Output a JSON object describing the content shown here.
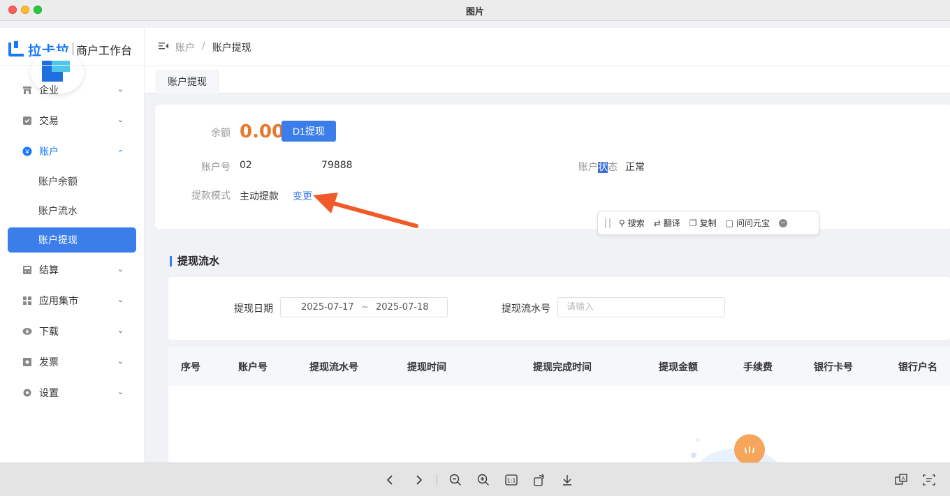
{
  "window": {
    "title": "图片"
  },
  "sidebar": {
    "brand": "拉卡拉",
    "brand_sub": "商户工作台",
    "menu": [
      {
        "label": "企业",
        "icon": "store-icon"
      },
      {
        "label": "交易",
        "icon": "check-square-icon"
      },
      {
        "label": "账户",
        "icon": "yen-circle-icon",
        "open": true,
        "children": [
          {
            "label": "账户余额"
          },
          {
            "label": "账户流水"
          },
          {
            "label": "账户提现",
            "active": true
          }
        ]
      },
      {
        "label": "结算",
        "icon": "calculator-icon"
      },
      {
        "label": "应用集市",
        "icon": "grid-icon"
      },
      {
        "label": "下载",
        "icon": "cloud-download-icon"
      },
      {
        "label": "发票",
        "icon": "invoice-icon"
      },
      {
        "label": "设置",
        "icon": "gear-icon"
      }
    ]
  },
  "header": {
    "breadcrumb": [
      "账户",
      "账户提现"
    ],
    "breadcrumb_sep": "/"
  },
  "tabs": [
    {
      "label": "账户提现"
    }
  ],
  "account": {
    "balance_label": "余额",
    "balance_value": "0.00",
    "d1_button": "D1提现",
    "account_no_label": "账户号",
    "account_no_prefix": "02",
    "account_no_suffix": "79888",
    "status_label_pre": "账户",
    "status_label_hl": "状",
    "status_label_post": "态",
    "status_value": "正常",
    "mode_label": "提款模式",
    "mode_value": "主动提款",
    "change_link": "变更"
  },
  "selection_toolbar": {
    "items": [
      "搜索",
      "翻译",
      "复制",
      "问问元宝"
    ]
  },
  "withdraw": {
    "section_title": "提现流水",
    "date_label": "提现日期",
    "date_start": "2025-07-17",
    "date_sep": "~",
    "date_end": "2025-07-18",
    "serial_label": "提现流水号",
    "serial_placeholder": "请输入",
    "columns": [
      "序号",
      "账户号",
      "提现流水号",
      "提现时间",
      "提现完成时间",
      "提现金额",
      "手续费",
      "银行卡号",
      "银行户名"
    ]
  },
  "colors": {
    "accent": "#3b7de9",
    "balance": "#e8772e",
    "annotation_arrow": "#f05a28"
  }
}
